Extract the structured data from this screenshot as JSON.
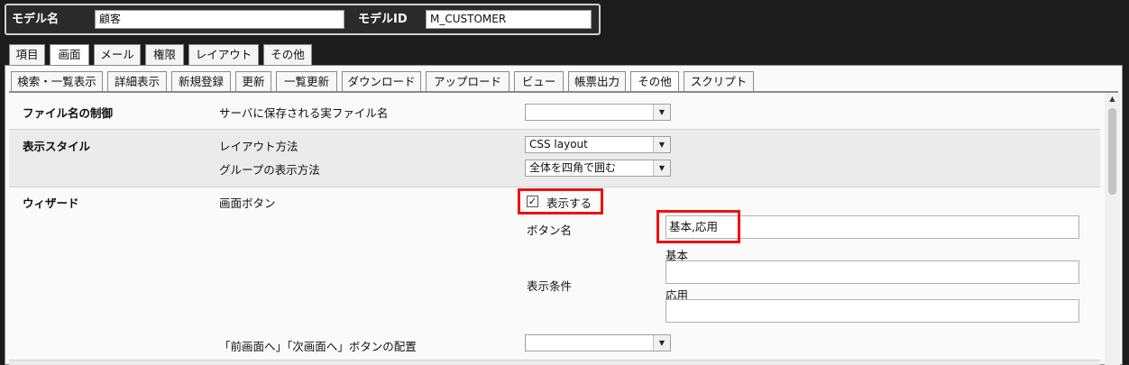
{
  "model_bar": {
    "name_label": "モデル名",
    "name_value": "顧客",
    "id_label": "モデルID",
    "id_value": "M_CUSTOMER"
  },
  "main_tabs": [
    {
      "label": "項目"
    },
    {
      "label": "画面"
    },
    {
      "label": "メール"
    },
    {
      "label": "権限"
    },
    {
      "label": "レイアウト"
    },
    {
      "label": "その他"
    }
  ],
  "sub_tabs": [
    {
      "label": "検索・一覧表示"
    },
    {
      "label": "詳細表示"
    },
    {
      "label": "新規登録"
    },
    {
      "label": "更新"
    },
    {
      "label": "一覧更新"
    },
    {
      "label": "ダウンロード"
    },
    {
      "label": "アップロード"
    },
    {
      "label": "ビュー"
    },
    {
      "label": "帳票出力"
    },
    {
      "label": "その他"
    },
    {
      "label": "スクリプト"
    }
  ],
  "sections": {
    "file_name": {
      "title": "ファイル名の制御",
      "row_label": "サーバに保存される実ファイル名",
      "select_value": ""
    },
    "display_style": {
      "title": "表示スタイル",
      "layout_label": "レイアウト方法",
      "layout_value": "CSS layout",
      "group_label": "グループの表示方法",
      "group_value": "全体を四角で囲む"
    },
    "wizard": {
      "title": "ウィザード",
      "screen_button_label": "画面ボタン",
      "show_checkbox_label": "表示する",
      "show_checked": true,
      "check_mark": "✓",
      "button_name_label": "ボタン名",
      "button_name_value": "基本,応用",
      "condition_label": "表示条件",
      "cond_basic_label": "基本",
      "cond_basic_value": "",
      "cond_applied_label": "応用",
      "cond_applied_value": "",
      "nav_button_label": "「前画面へ」「次画面へ」ボタンの配置",
      "nav_button_value": ""
    }
  },
  "icons": {
    "dropdown_arrow": "▼",
    "scroll_up": "▲"
  },
  "colors": {
    "highlight": "#e11111",
    "background": "#1c1c1c"
  }
}
